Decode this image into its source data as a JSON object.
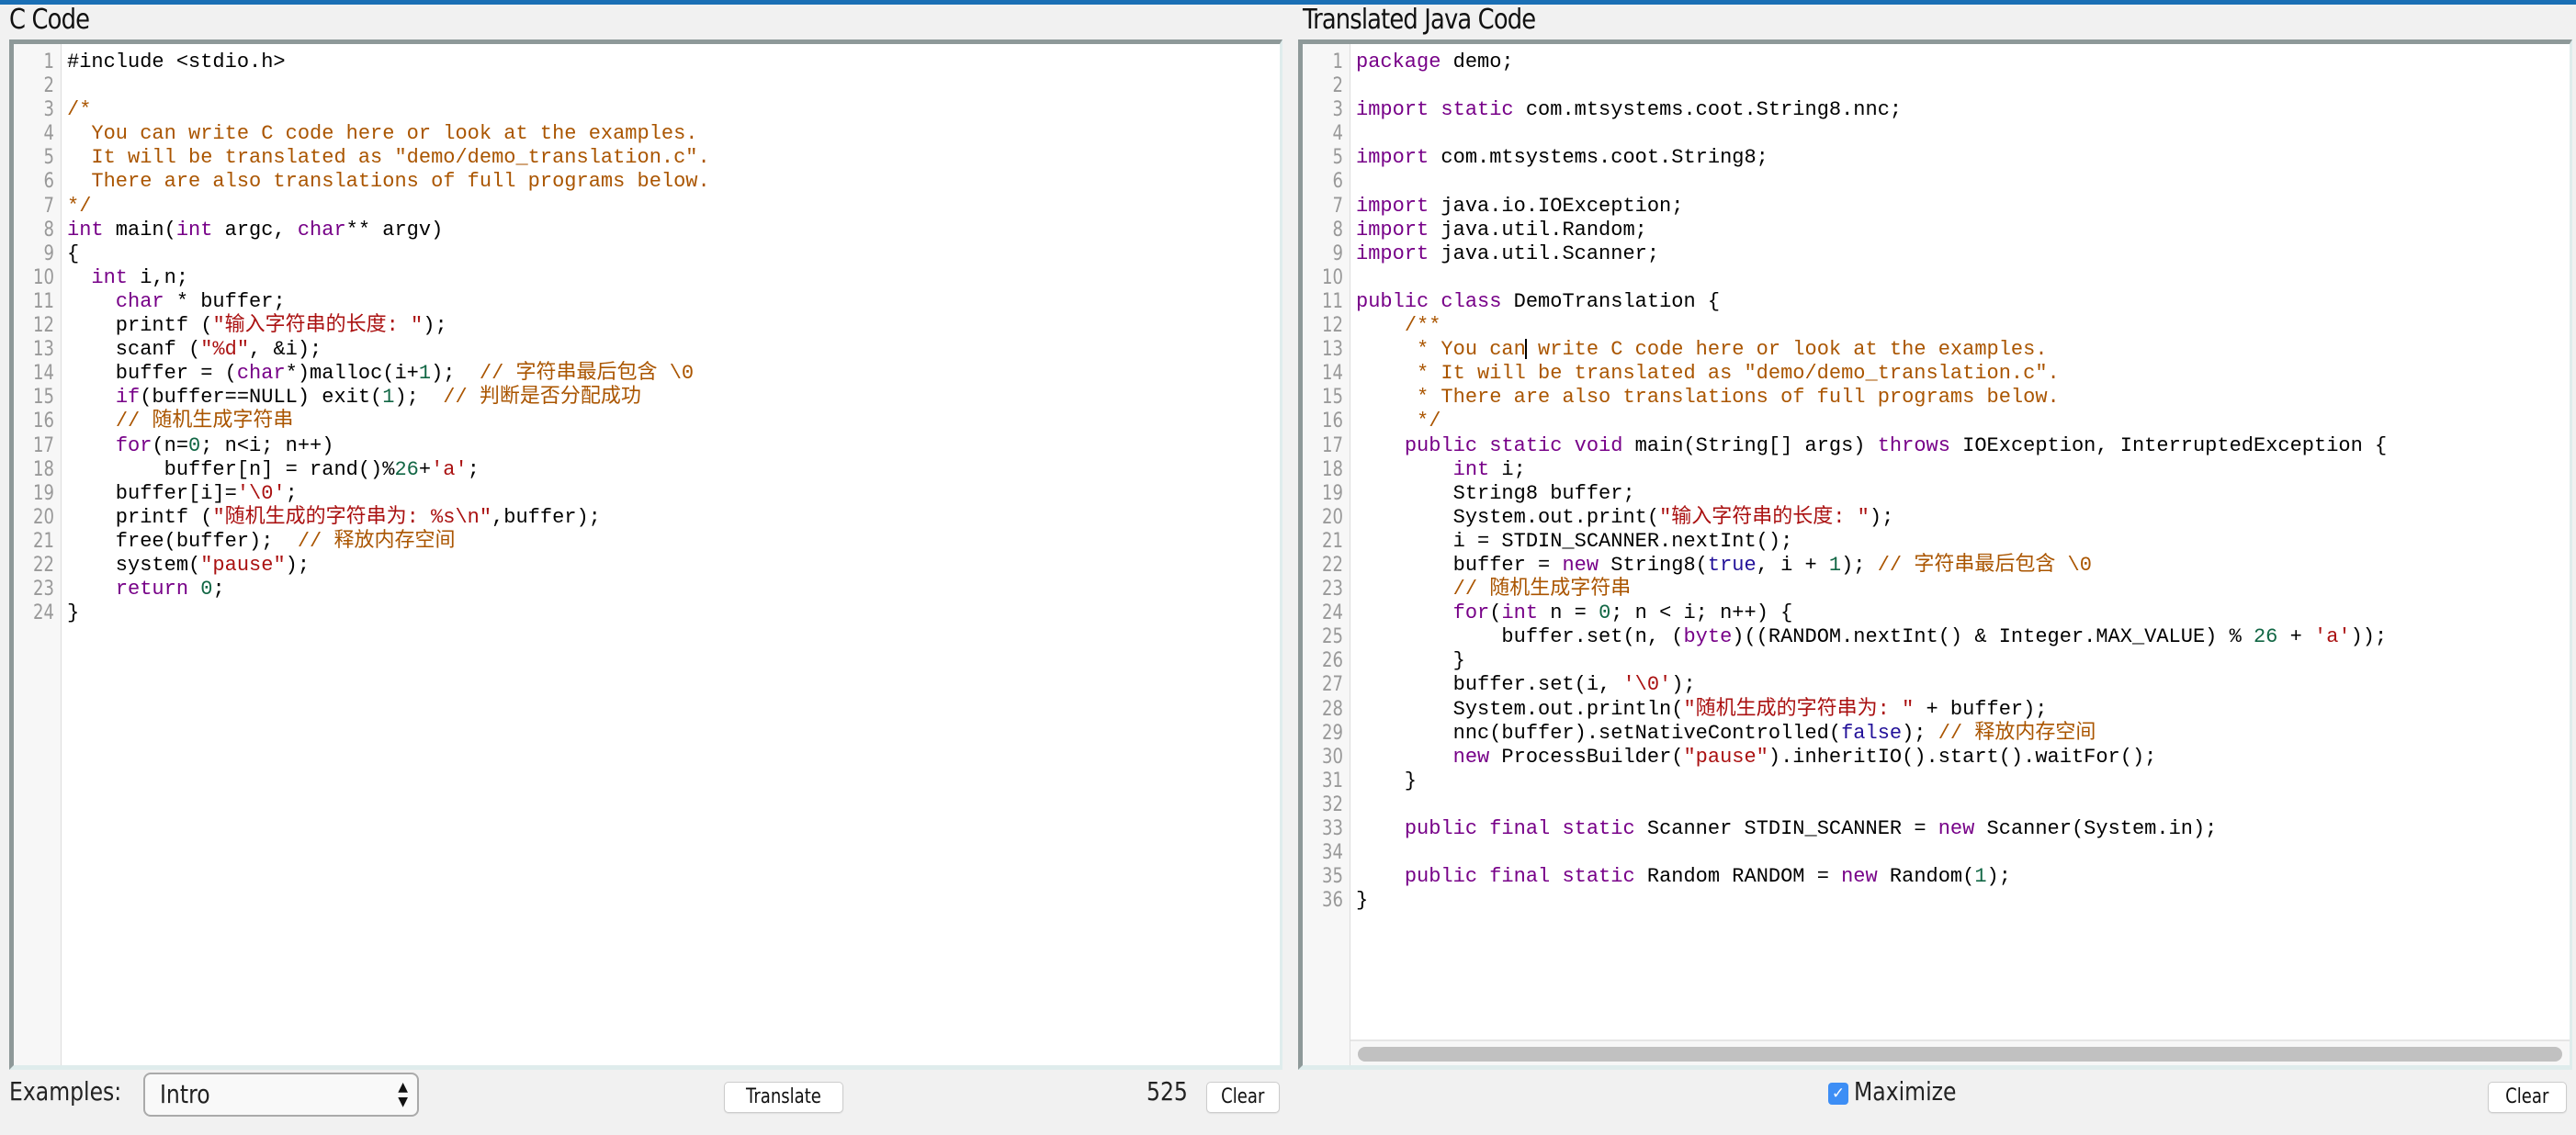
{
  "left_pane": {
    "title": "C Code",
    "lines": [
      [
        [
          "def",
          "#include <stdio.h>"
        ]
      ],
      [],
      [
        [
          "com",
          "/*"
        ]
      ],
      [
        [
          "com",
          "  You can write C code here or look at the examples."
        ]
      ],
      [
        [
          "com",
          "  It will be translated as \"demo/demo_translation.c\"."
        ]
      ],
      [
        [
          "com",
          "  There are also translations of full programs below."
        ]
      ],
      [
        [
          "com",
          "*/"
        ]
      ],
      [
        [
          "kw",
          "int"
        ],
        [
          "def",
          " main("
        ],
        [
          "kw",
          "int"
        ],
        [
          "def",
          " argc, "
        ],
        [
          "kw",
          "char"
        ],
        [
          "def",
          "** argv)"
        ]
      ],
      [
        [
          "def",
          "{"
        ]
      ],
      [
        [
          "def",
          "  "
        ],
        [
          "kw",
          "int"
        ],
        [
          "def",
          " i,n;"
        ]
      ],
      [
        [
          "def",
          "    "
        ],
        [
          "kw",
          "char"
        ],
        [
          "def",
          " * buffer;"
        ]
      ],
      [
        [
          "def",
          "    printf ("
        ],
        [
          "str",
          "\"输入字符串的长度: \""
        ],
        [
          "def",
          ");"
        ]
      ],
      [
        [
          "def",
          "    scanf ("
        ],
        [
          "str",
          "\"%d\""
        ],
        [
          "def",
          ", &i);"
        ]
      ],
      [
        [
          "def",
          "    buffer = ("
        ],
        [
          "kw",
          "char"
        ],
        [
          "def",
          "*)malloc(i+"
        ],
        [
          "num",
          "1"
        ],
        [
          "def",
          ");  "
        ],
        [
          "com",
          "// 字符串最后包含 \\0"
        ]
      ],
      [
        [
          "def",
          "    "
        ],
        [
          "kw",
          "if"
        ],
        [
          "def",
          "(buffer==NULL) exit("
        ],
        [
          "num",
          "1"
        ],
        [
          "def",
          ");  "
        ],
        [
          "com",
          "// 判断是否分配成功"
        ]
      ],
      [
        [
          "def",
          "    "
        ],
        [
          "com",
          "// 随机生成字符串"
        ]
      ],
      [
        [
          "def",
          "    "
        ],
        [
          "kw",
          "for"
        ],
        [
          "def",
          "(n="
        ],
        [
          "num",
          "0"
        ],
        [
          "def",
          "; n<i; n++)"
        ]
      ],
      [
        [
          "def",
          "        buffer[n] = rand()%"
        ],
        [
          "num",
          "26"
        ],
        [
          "def",
          "+"
        ],
        [
          "str",
          "'a'"
        ],
        [
          "def",
          ";"
        ]
      ],
      [
        [
          "def",
          "    buffer[i]="
        ],
        [
          "str",
          "'\\0'"
        ],
        [
          "def",
          ";"
        ]
      ],
      [
        [
          "def",
          "    printf ("
        ],
        [
          "str",
          "\"随机生成的字符串为: %s\\n\""
        ],
        [
          "def",
          ",buffer);"
        ]
      ],
      [
        [
          "def",
          "    free(buffer);  "
        ],
        [
          "com",
          "// 释放内存空间"
        ]
      ],
      [
        [
          "def",
          "    system("
        ],
        [
          "str",
          "\"pause\""
        ],
        [
          "def",
          ");"
        ]
      ],
      [
        [
          "def",
          "    "
        ],
        [
          "kw",
          "return"
        ],
        [
          "def",
          " "
        ],
        [
          "num",
          "0"
        ],
        [
          "def",
          ";"
        ]
      ],
      [
        [
          "def",
          "}"
        ]
      ]
    ]
  },
  "right_pane": {
    "title": "Translated Java Code",
    "cursor": {
      "line": 13,
      "after_chars": 14
    },
    "lines": [
      [
        [
          "kw",
          "package"
        ],
        [
          "def",
          " demo;"
        ]
      ],
      [],
      [
        [
          "kw",
          "import"
        ],
        [
          "def",
          " "
        ],
        [
          "kw",
          "static"
        ],
        [
          "def",
          " com.mtsystems.coot.String8.nnc;"
        ]
      ],
      [],
      [
        [
          "kw",
          "import"
        ],
        [
          "def",
          " com.mtsystems.coot.String8;"
        ]
      ],
      [],
      [
        [
          "kw",
          "import"
        ],
        [
          "def",
          " java.io.IOException;"
        ]
      ],
      [
        [
          "kw",
          "import"
        ],
        [
          "def",
          " java.util.Random;"
        ]
      ],
      [
        [
          "kw",
          "import"
        ],
        [
          "def",
          " java.util.Scanner;"
        ]
      ],
      [],
      [
        [
          "kw",
          "public"
        ],
        [
          "def",
          " "
        ],
        [
          "kw",
          "class"
        ],
        [
          "def",
          " DemoTranslation {"
        ]
      ],
      [
        [
          "def",
          "    "
        ],
        [
          "com",
          "/**"
        ]
      ],
      [
        [
          "def",
          "     "
        ],
        [
          "com",
          "* You can write C code here or look at the examples."
        ]
      ],
      [
        [
          "def",
          "     "
        ],
        [
          "com",
          "* It will be translated as \"demo/demo_translation.c\"."
        ]
      ],
      [
        [
          "def",
          "     "
        ],
        [
          "com",
          "* There are also translations of full programs below."
        ]
      ],
      [
        [
          "def",
          "     "
        ],
        [
          "com",
          "*/"
        ]
      ],
      [
        [
          "def",
          "    "
        ],
        [
          "kw",
          "public"
        ],
        [
          "def",
          " "
        ],
        [
          "kw",
          "static"
        ],
        [
          "def",
          " "
        ],
        [
          "kw",
          "void"
        ],
        [
          "def",
          " main(String[] args) "
        ],
        [
          "kw",
          "throws"
        ],
        [
          "def",
          " IOException, InterruptedException {"
        ]
      ],
      [
        [
          "def",
          "        "
        ],
        [
          "kw",
          "int"
        ],
        [
          "def",
          " i;"
        ]
      ],
      [
        [
          "def",
          "        String8 buffer;"
        ]
      ],
      [
        [
          "def",
          "        System.out.print("
        ],
        [
          "str",
          "\"输入字符串的长度: \""
        ],
        [
          "def",
          ");"
        ]
      ],
      [
        [
          "def",
          "        i = STDIN_SCANNER.nextInt();"
        ]
      ],
      [
        [
          "def",
          "        buffer = "
        ],
        [
          "kw",
          "new"
        ],
        [
          "def",
          " String8("
        ],
        [
          "atom",
          "true"
        ],
        [
          "def",
          ", i + "
        ],
        [
          "num",
          "1"
        ],
        [
          "def",
          "); "
        ],
        [
          "com",
          "// 字符串最后包含 \\0"
        ]
      ],
      [
        [
          "def",
          "        "
        ],
        [
          "com",
          "// 随机生成字符串"
        ]
      ],
      [
        [
          "def",
          "        "
        ],
        [
          "kw",
          "for"
        ],
        [
          "def",
          "("
        ],
        [
          "kw",
          "int"
        ],
        [
          "def",
          " n = "
        ],
        [
          "num",
          "0"
        ],
        [
          "def",
          "; n < i; n++) {"
        ]
      ],
      [
        [
          "def",
          "            buffer.set(n, ("
        ],
        [
          "kw",
          "byte"
        ],
        [
          "def",
          ")((RANDOM.nextInt() & Integer.MAX_VALUE) % "
        ],
        [
          "num",
          "26"
        ],
        [
          "def",
          " + "
        ],
        [
          "str",
          "'a'"
        ],
        [
          "def",
          "));"
        ]
      ],
      [
        [
          "def",
          "        }"
        ]
      ],
      [
        [
          "def",
          "        buffer.set(i, "
        ],
        [
          "str",
          "'\\0'"
        ],
        [
          "def",
          ");"
        ]
      ],
      [
        [
          "def",
          "        System.out.println("
        ],
        [
          "str",
          "\"随机生成的字符串为: \""
        ],
        [
          "def",
          " + buffer);"
        ]
      ],
      [
        [
          "def",
          "        nnc(buffer).setNativeControlled("
        ],
        [
          "atom",
          "false"
        ],
        [
          "def",
          "); "
        ],
        [
          "com",
          "// 释放内存空间"
        ]
      ],
      [
        [
          "def",
          "        "
        ],
        [
          "kw",
          "new"
        ],
        [
          "def",
          " ProcessBuilder("
        ],
        [
          "str",
          "\"pause\""
        ],
        [
          "def",
          ").inheritIO().start().waitFor();"
        ]
      ],
      [
        [
          "def",
          "    }"
        ]
      ],
      [],
      [
        [
          "def",
          "    "
        ],
        [
          "kw",
          "public"
        ],
        [
          "def",
          " "
        ],
        [
          "kw",
          "final"
        ],
        [
          "def",
          " "
        ],
        [
          "kw",
          "static"
        ],
        [
          "def",
          " Scanner STDIN_SCANNER = "
        ],
        [
          "kw",
          "new"
        ],
        [
          "def",
          " Scanner(System.in);"
        ]
      ],
      [],
      [
        [
          "def",
          "    "
        ],
        [
          "kw",
          "public"
        ],
        [
          "def",
          " "
        ],
        [
          "kw",
          "final"
        ],
        [
          "def",
          " "
        ],
        [
          "kw",
          "static"
        ],
        [
          "def",
          " Random RANDOM = "
        ],
        [
          "kw",
          "new"
        ],
        [
          "def",
          " Random("
        ],
        [
          "num",
          "1"
        ],
        [
          "def",
          ");"
        ]
      ],
      [
        [
          "def",
          "}"
        ]
      ]
    ]
  },
  "bottom_left": {
    "examples_label": "Examples:",
    "examples_selected": "Intro",
    "translate_label": "Translate",
    "char_count": "525",
    "clear_label": "Clear"
  },
  "bottom_right": {
    "maximize_label": "Maximize",
    "maximize_checked": true,
    "clear_label": "Clear"
  },
  "icons": {
    "select_arrows": "updown-arrows-icon",
    "checkbox_check": "checkmark-icon"
  },
  "colors": {
    "accent_bar": "#1a6fb5",
    "keyword": "#770088",
    "string": "#aa1111",
    "comment": "#aa5500",
    "number": "#116644",
    "atom": "#221199",
    "checkbox": "#3d8ef5"
  }
}
